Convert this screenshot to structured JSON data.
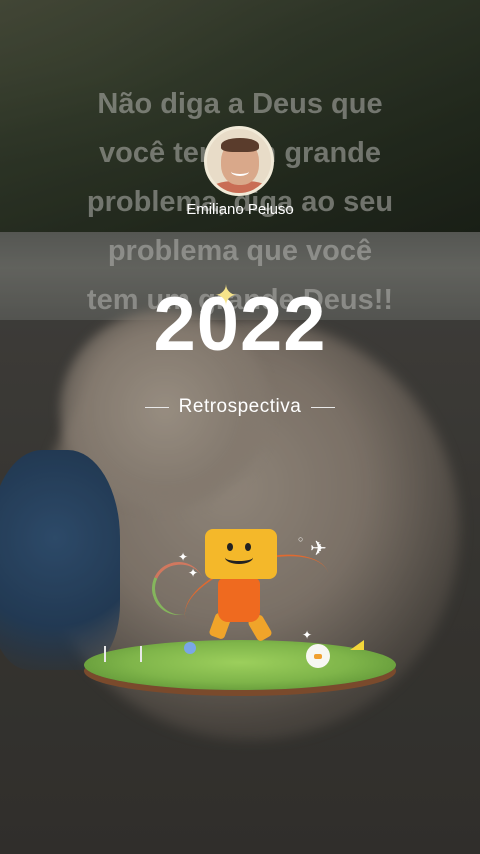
{
  "quote": {
    "lines": [
      "Não diga a Deus que",
      "você tem um grande",
      "problema, diga ao seu",
      "problema que você",
      "tem um grande Deus!!"
    ]
  },
  "profile": {
    "name": "Emiliano Peluso"
  },
  "title": {
    "year": "2022",
    "subtitle": "Retrospectiva"
  },
  "icons": {
    "sparkle": "sparkle-icon",
    "plane": "paper-plane-icon",
    "star": "star-icon"
  },
  "colors": {
    "text": "#ffffff",
    "sparkle": "#f6e48a",
    "robot_head": "#f4b82a",
    "robot_body": "#ef6a1f",
    "grass": "#7fb54a"
  }
}
